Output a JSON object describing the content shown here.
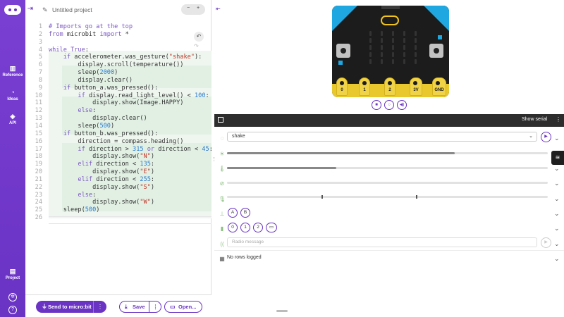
{
  "sidebar": {
    "items": [
      {
        "label": "Reference",
        "icon": "book-icon"
      },
      {
        "label": "Ideas",
        "icon": "lightbulb-icon"
      },
      {
        "label": "API",
        "icon": "api-icon"
      },
      {
        "label": "Project",
        "icon": "project-icon"
      }
    ],
    "bottom_icons": [
      "settings-icon",
      "help-icon"
    ]
  },
  "editor": {
    "project_name": "Untitled project",
    "zoom_out": "−",
    "zoom_in": "+",
    "lines": [
      "# Imports go at the top",
      "from microbit import *",
      "",
      "while True:",
      "    if accelerometer.was_gesture(\"shake\"):",
      "        display.scroll(temperature())",
      "        sleep(2000)",
      "        display.clear()",
      "    if button_a.was_pressed():",
      "        if display.read_light_level() < 100:",
      "            display.show(Image.HAPPY)",
      "        else:",
      "            display.clear()",
      "        sleep(500)",
      "    if button_b.was_pressed():",
      "        direction = compass.heading()",
      "        if direction > 315 or direction < 45:",
      "            display.show(\"N\")",
      "        elif direction < 135:",
      "            display.show(\"E\")",
      "        elif direction < 255:",
      "            display.show(\"S\")",
      "        else:",
      "            display.show(\"W\")",
      "    sleep(500)",
      ""
    ]
  },
  "footer": {
    "send_label": "Send to micro:bit",
    "save_label": "Save",
    "open_label": "Open..."
  },
  "simulator": {
    "pins": [
      "0",
      "1",
      "2",
      "3V",
      "GND"
    ],
    "serial_toggle": "Show serial",
    "gesture_value": "shake",
    "light_level": 0.71,
    "temperature_level": 0.34,
    "buttons": [
      "A",
      "B"
    ],
    "touch_pins": [
      "0",
      "1",
      "2"
    ],
    "radio_placeholder": "Radio message",
    "log_text": "No rows logged"
  },
  "colors": {
    "accent": "#6a33c4",
    "board": "#1c1c1c",
    "gold": "#f2c318",
    "corner": "#1ea7e1"
  }
}
